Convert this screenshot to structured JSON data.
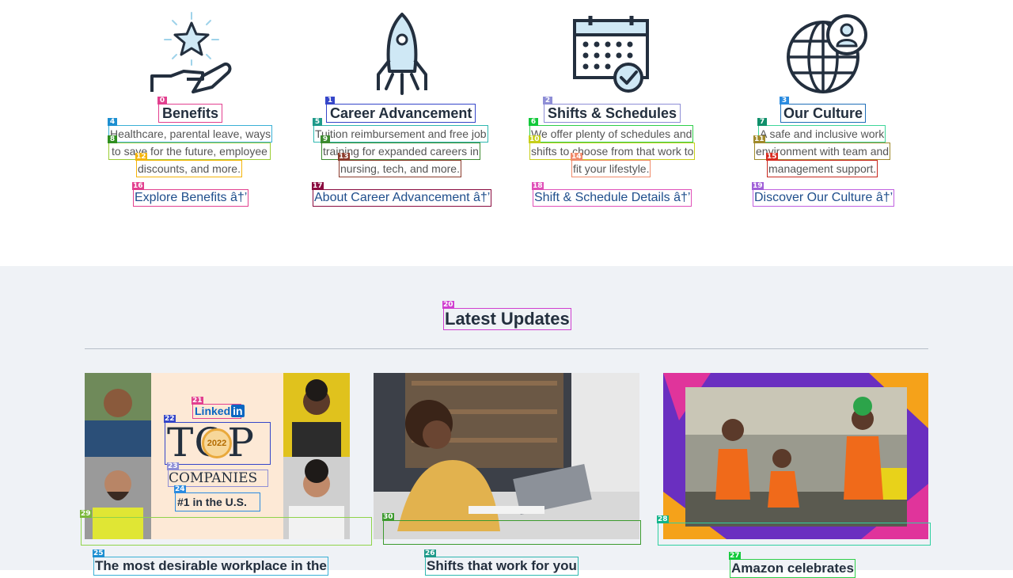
{
  "colors": {
    "text_dark": "#232f3e",
    "text_body": "#555555",
    "link": "#1f4e8c",
    "section_bg": "#eff2f6",
    "icon_fill": "#cfe8f5"
  },
  "features": [
    {
      "icon": "hand-star-icon",
      "tag_title": "0",
      "title": "Benefits",
      "tag_d1": "4",
      "desc1": "Healthcare, parental leave, ways",
      "tag_d2": "8",
      "desc2": "to save for the future, employee",
      "tag_d3": "12",
      "desc3": "discounts, and more.",
      "tag_link": "16",
      "link": "Explore Benefits â†’"
    },
    {
      "icon": "rocket-icon",
      "tag_title": "1",
      "title": "Career Advancement",
      "tag_d1": "5",
      "desc1": "Tuition reimbursement and free job",
      "tag_d2": "9",
      "desc2": "training for expanded careers in",
      "tag_d3": "13",
      "desc3": "nursing, tech, and more.",
      "tag_link": "17",
      "link": "About Career Advancement â†’"
    },
    {
      "icon": "calendar-check-icon",
      "tag_title": "2",
      "title": "Shifts & Schedules",
      "tag_d1": "6",
      "desc1": "We offer plenty of schedules and",
      "tag_d2": "10",
      "desc2": "shifts to choose from that work to",
      "tag_d3": "14",
      "desc3": "fit your lifestyle.",
      "tag_link": "18",
      "link": "Shift & Schedule Details â†’"
    },
    {
      "icon": "globe-person-icon",
      "tag_title": "3",
      "title": "Our Culture",
      "tag_d1": "7",
      "desc1": "A safe and inclusive work",
      "tag_d2": "11",
      "desc2": "environment with team and",
      "tag_d3": "15",
      "desc3": "management support.",
      "tag_link": "19",
      "link": "Discover Our Culture â†’"
    }
  ],
  "updates": {
    "tag_heading": "20",
    "heading": "Latest Updates",
    "cards": [
      {
        "tag_link": "29",
        "tag_title": "25",
        "title": "The most desirable workplace in the",
        "badge": {
          "tag_logo": "21",
          "logo_text": "Linked",
          "logo_in": "in",
          "tag_top": "22",
          "top_text": "TOP",
          "year": "2022",
          "tag_companies": "23",
          "companies_text": "COMPANIES",
          "tag_rank": "24",
          "rank_text": "#1 in the U.S."
        }
      },
      {
        "tag_link": "30",
        "tag_title": "26",
        "title": "Shifts that work for you"
      },
      {
        "tag_link": "28",
        "tag_title": "27",
        "title": "Amazon celebrates"
      }
    ]
  }
}
